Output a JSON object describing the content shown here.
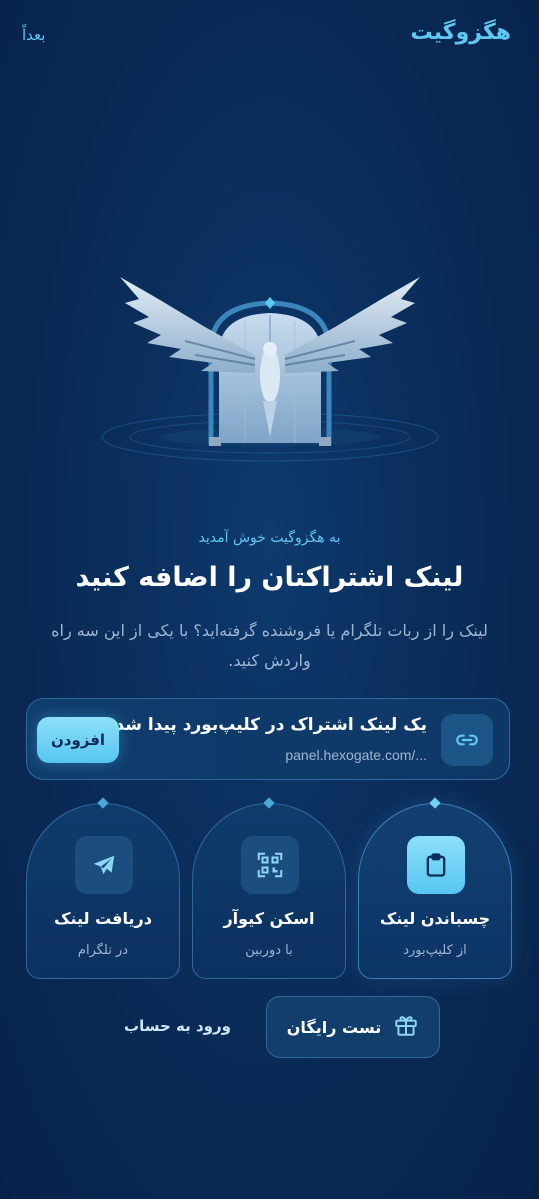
{
  "header": {
    "brand": "هگزوگیت",
    "later_label": "بعداً"
  },
  "welcome": {
    "subtitle": "به هگزوگیت خوش آمدید",
    "title": "لینک اشتراکتان را اضافه کنید",
    "description": "لینک را از ربات تلگرام یا فروشنده گرفته‌اید؟ با یکی از این سه راه واردش کنید."
  },
  "clipboard_card": {
    "icon": "link-icon",
    "title": "یک لینک اشتراک در کلیپ‌بورد پیدا شد",
    "url": "panel.hexogate.com/...",
    "add_label": "افزودن"
  },
  "options": [
    {
      "title": "چسباندن لینک",
      "subtitle": "از کلیپ‌بورد",
      "icon": "clipboard-icon",
      "active": true
    },
    {
      "title": "اسکن کیوآر",
      "subtitle": "با دوربین",
      "icon": "qr-code-icon",
      "active": false
    },
    {
      "title": "دریافت لینک",
      "subtitle": "در تلگرام",
      "icon": "telegram-icon",
      "active": false
    }
  ],
  "footer": {
    "trial_label": "تست رایگان",
    "trial_icon": "gift-icon",
    "login_label": "ورود به حساب"
  },
  "colors": {
    "accent": "#5fc8f2",
    "background": "#0a2d5a",
    "card": "#0f3c6c",
    "border": "#2e6a9c",
    "muted_text": "#9fb6d3"
  }
}
